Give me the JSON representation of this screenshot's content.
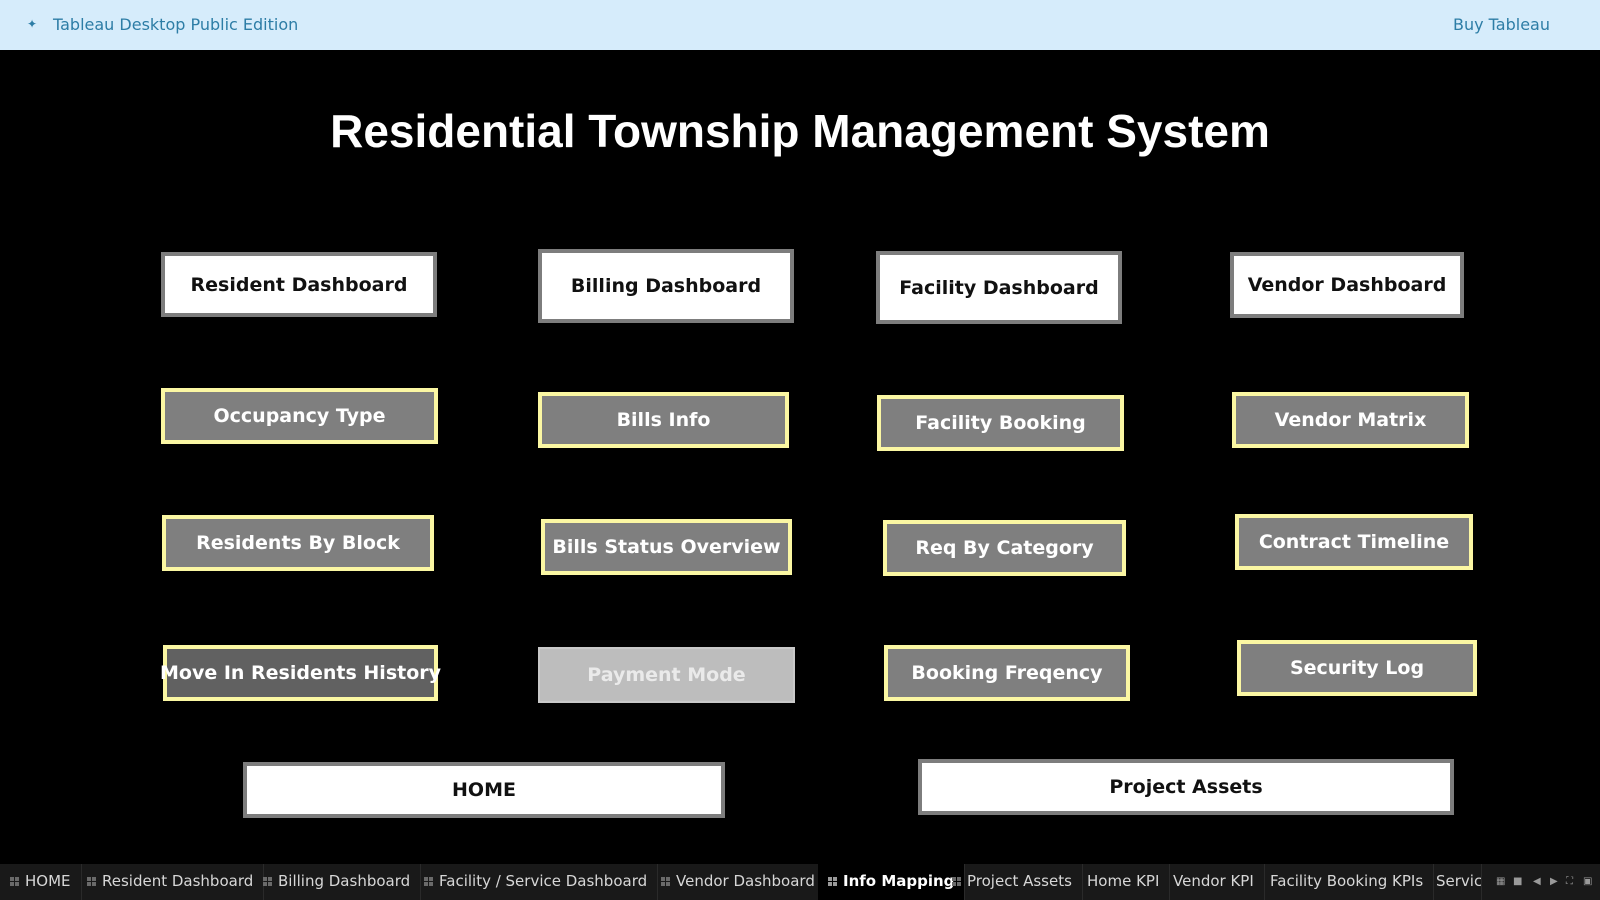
{
  "topbar": {
    "logo_icon": "tableau-logo-icon",
    "edition": "Tableau Desktop Public Edition",
    "buy": "Buy Tableau"
  },
  "title": "Residential Township Management System",
  "buttons": {
    "resident_dashboard": "Resident Dashboard",
    "billing_dashboard": "Billing Dashboard",
    "facility_dashboard": "Facility Dashboard",
    "vendor_dashboard": "Vendor Dashboard",
    "occupancy_type": "Occupancy Type",
    "bills_info": "Bills Info",
    "facility_booking": "Facility Booking",
    "vendor_matrix": "Vendor Matrix",
    "residents_by_block": "Residents By Block",
    "bills_status_overview": "Bills Status Overview",
    "req_by_category": "Req By Category",
    "contract_timeline": "Contract Timeline",
    "move_in_residents_history": "Move In Residents History",
    "payment_mode": "Payment Mode",
    "booking_freqency": "Booking Freqency",
    "security_log": "Security Log",
    "home": "HOME",
    "project_assets": "Project Assets"
  },
  "tabs": [
    {
      "label": "HOME",
      "active": false
    },
    {
      "label": "Resident Dashboard",
      "active": false
    },
    {
      "label": "Billing Dashboard",
      "active": false
    },
    {
      "label": "Facility / Service Dashboard",
      "active": false
    },
    {
      "label": "Vendor Dashboard",
      "active": false
    },
    {
      "label": "Info Mapping",
      "active": true
    },
    {
      "label": "Project Assets",
      "active": false
    },
    {
      "label": "Home KPI",
      "active": false
    },
    {
      "label": "Vendor KPI",
      "active": false
    },
    {
      "label": "Facility Booking KPIs",
      "active": false
    },
    {
      "label": "Servic",
      "active": false
    }
  ],
  "colors": {
    "topbar_bg": "#d6ecfb",
    "topbar_text": "#2d7da6",
    "canvas_bg": "#000000",
    "button_grey": "#7f7f7f",
    "button_highlight_border": "#fbf7a3",
    "button_white_border": "#7d7d7d"
  }
}
